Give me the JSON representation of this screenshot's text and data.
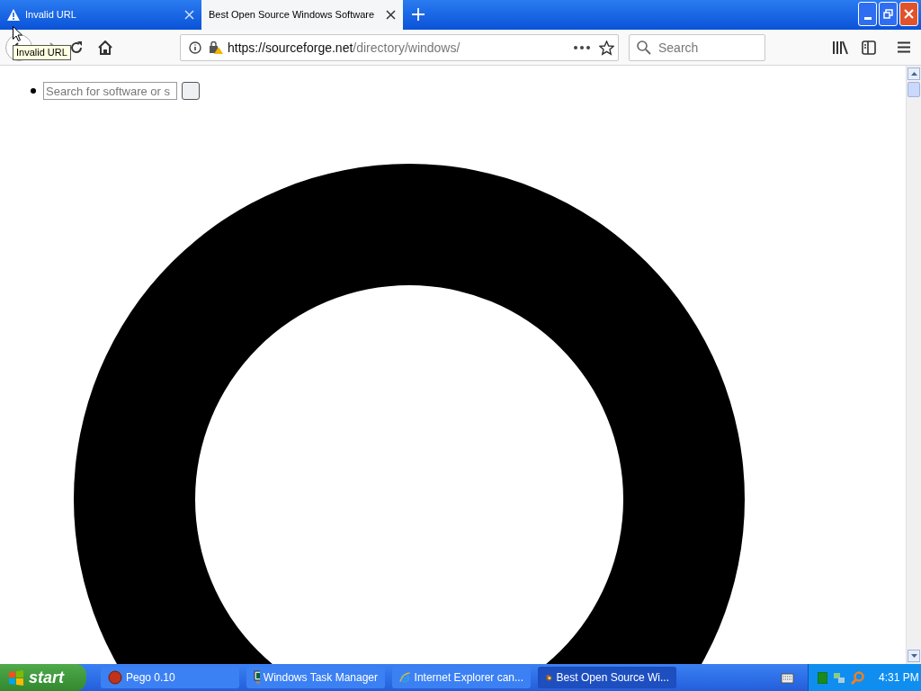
{
  "tabs": [
    {
      "title": "Invalid URL",
      "selected": false,
      "kind": "warning"
    },
    {
      "title": "Best Open Source Windows Software",
      "selected": true,
      "kind": "plain"
    }
  ],
  "tooltip": "Invalid URL",
  "address": {
    "host": "https://sourceforge.net",
    "path": "/directory/windows/"
  },
  "search": {
    "placeholder": "Search"
  },
  "page": {
    "search_field": {
      "placeholder": "Search for software or s"
    }
  },
  "taskbar": {
    "start": "start",
    "tasks": [
      {
        "label": "Pego 0.10",
        "kind": "pego",
        "selected": false
      },
      {
        "label": "Windows Task Manager",
        "kind": "taskmgr",
        "selected": false
      },
      {
        "label": "Internet Explorer can...",
        "kind": "ie",
        "selected": false
      },
      {
        "label": "Best Open Source Wi...",
        "kind": "firefox",
        "selected": true
      }
    ],
    "clock": "4:31 PM"
  }
}
